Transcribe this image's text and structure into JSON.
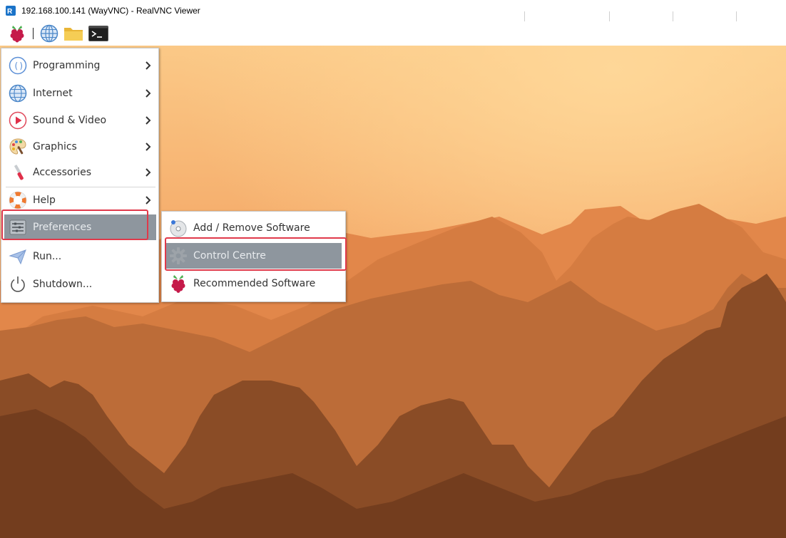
{
  "window": {
    "title": "192.168.100.141 (WayVNC) - RealVNC Viewer"
  },
  "taskbar": {
    "items": [
      {
        "name": "raspberry-menu-icon"
      },
      {
        "name": "web-browser-icon"
      },
      {
        "name": "file-manager-icon"
      },
      {
        "name": "terminal-icon"
      }
    ]
  },
  "menu": {
    "items": [
      {
        "label": "Programming",
        "icon": "programming-icon",
        "submenu": true
      },
      {
        "label": "Internet",
        "icon": "globe-icon",
        "submenu": true
      },
      {
        "label": "Sound & Video",
        "icon": "play-icon",
        "submenu": true
      },
      {
        "label": "Graphics",
        "icon": "palette-icon",
        "submenu": true
      },
      {
        "label": "Accessories",
        "icon": "knife-icon",
        "submenu": true
      },
      {
        "label": "Help",
        "icon": "lifebuoy-icon",
        "submenu": true
      },
      {
        "label": "Preferences",
        "icon": "preferences-icon",
        "submenu": false,
        "selected": true
      },
      {
        "label": "Run...",
        "icon": "send-icon",
        "submenu": false
      },
      {
        "label": "Shutdown...",
        "icon": "power-icon",
        "submenu": false
      }
    ]
  },
  "submenu": {
    "items": [
      {
        "label": "Add / Remove Software",
        "icon": "software-disc-icon"
      },
      {
        "label": "Control Centre",
        "icon": "gear-icon",
        "selected": true
      },
      {
        "label": "Recommended Software",
        "icon": "raspberry-icon"
      }
    ]
  },
  "colors": {
    "selection": "#8e969e",
    "highlight_border": "#e0394a",
    "sky_top": "#f8c27a",
    "sky_horizon": "#f0914a"
  }
}
